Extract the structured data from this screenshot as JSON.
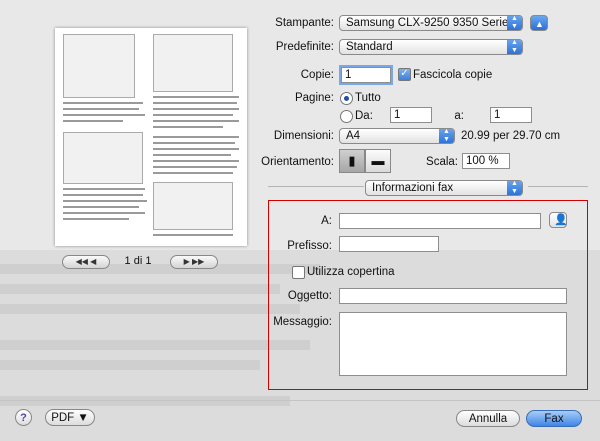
{
  "printer": {
    "label": "Stampante:",
    "value": "Samsung CLX-9250 9350 Serie..."
  },
  "presets": {
    "label": "Predefinite:",
    "value": "Standard"
  },
  "copies": {
    "label": "Copie:",
    "value": "1",
    "collate_label": "Fascicola copie",
    "collate_checked": true
  },
  "pages": {
    "label": "Pagine:",
    "all_label": "Tutto",
    "from_label": "Da:",
    "from_value": "1",
    "to_label": "a:",
    "to_value": "1"
  },
  "size": {
    "label": "Dimensioni:",
    "value": "A4",
    "dims": "20.99 per 29.70 cm"
  },
  "orientation": {
    "label": "Orientamento:",
    "scale_label": "Scala:",
    "scale_value": "100 %"
  },
  "section": {
    "value": "Informazioni fax"
  },
  "fax": {
    "to_label": "A:",
    "to_value": "",
    "prefix_label": "Prefisso:",
    "prefix_value": "",
    "cover_label": "Utilizza copertina",
    "subject_label": "Oggetto:",
    "subject_value": "",
    "message_label": "Messaggio:",
    "message_value": ""
  },
  "preview": {
    "page_indicator": "1 di 1"
  },
  "footer": {
    "help": "?",
    "pdf_label": "PDF ▼",
    "cancel_label": "Annulla",
    "fax_label": "Fax"
  },
  "icons": {
    "person": "person-icon",
    "portrait": "portrait-icon",
    "landscape": "landscape-icon"
  },
  "colors": {
    "accent": "#3e86e6",
    "highlight_box": "#d40000"
  }
}
